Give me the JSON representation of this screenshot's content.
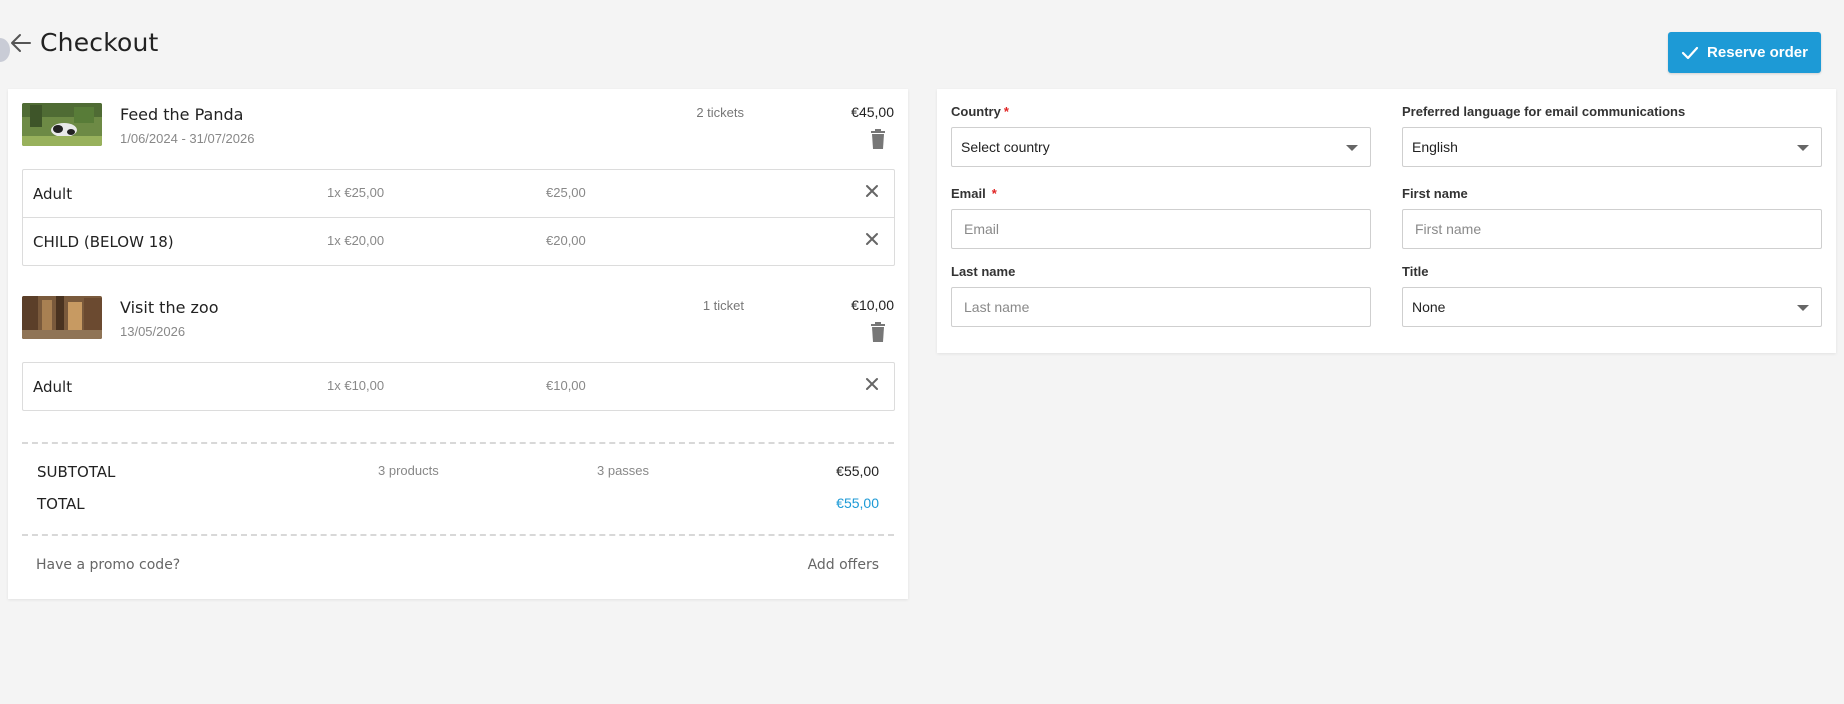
{
  "header": {
    "title": "Checkout",
    "reserve_label": "Reserve order"
  },
  "cart": {
    "products": [
      {
        "name": "Feed the Panda",
        "date": "1/06/2024 - 31/07/2026",
        "tickets": "2 tickets",
        "price": "€45,00",
        "lines": [
          {
            "name": "Adult",
            "qty": "1x €25,00",
            "total": "€25,00"
          },
          {
            "name": "CHILD (BELOW 18)",
            "qty": "1x €20,00",
            "total": "€20,00"
          }
        ]
      },
      {
        "name": "Visit the zoo",
        "date": "13/05/2026",
        "tickets": "1 ticket",
        "price": "€10,00",
        "lines": [
          {
            "name": "Adult",
            "qty": "1x €10,00",
            "total": "€10,00"
          }
        ]
      }
    ],
    "subtotal": {
      "label": "SUBTOTAL",
      "products": "3 products",
      "passes": "3 passes",
      "value": "€55,00"
    },
    "total": {
      "label": "TOTAL",
      "value": "€55,00"
    },
    "promo_label": "Have a promo code?",
    "offers_label": "Add offers"
  },
  "form": {
    "country": {
      "label": "Country",
      "required": "*",
      "value": "Select country"
    },
    "language": {
      "label": "Preferred language for email communications",
      "value": "English"
    },
    "email": {
      "label": "Email",
      "required": "*",
      "placeholder": "Email"
    },
    "first_name": {
      "label": "First name",
      "placeholder": "First name"
    },
    "last_name": {
      "label": "Last name",
      "placeholder": "Last name"
    },
    "title": {
      "label": "Title",
      "value": "None"
    }
  },
  "colors": {
    "accent": "#1d9ad6",
    "required": "#e02424",
    "background": "#f4f4f4"
  }
}
